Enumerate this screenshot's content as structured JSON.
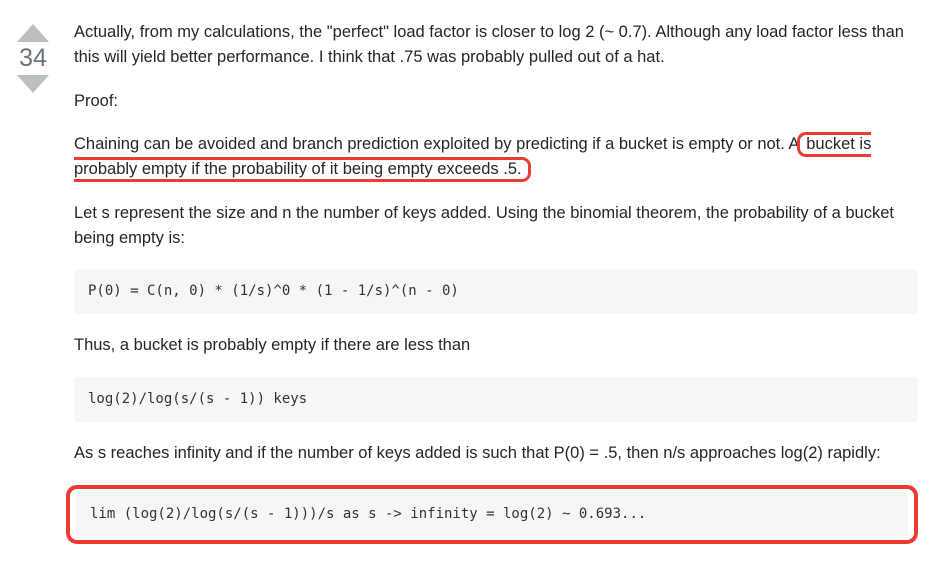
{
  "vote": {
    "count": "34"
  },
  "post": {
    "p1": "Actually, from my calculations, the \"perfect\" load factor is closer to log 2 (~ 0.7). Although any load factor less than this will yield better performance. I think that .75 was probably pulled out of a hat.",
    "p2": "Proof:",
    "p3_pre": "Chaining can be avoided and branch prediction exploited by predicting if a bucket is empty or not. A ",
    "p3_box": "bucket is probably empty if the probability of it being empty exceeds .5.",
    "p4": "Let s represent the size and n the number of keys added. Using the binomial theorem, the probability of a bucket being empty is:",
    "code1": "P(0) = C(n, 0) * (1/s)^0 * (1 - 1/s)^(n - 0)",
    "p5": "Thus, a bucket is probably empty if there are less than",
    "code2": "log(2)/log(s/(s - 1)) keys",
    "p6": "As s reaches infinity and if the number of keys added is such that P(0) = .5, then n/s approaches log(2) rapidly:",
    "code3": "lim (log(2)/log(s/(s - 1)))/s as s -> infinity = log(2) ~ 0.693..."
  }
}
